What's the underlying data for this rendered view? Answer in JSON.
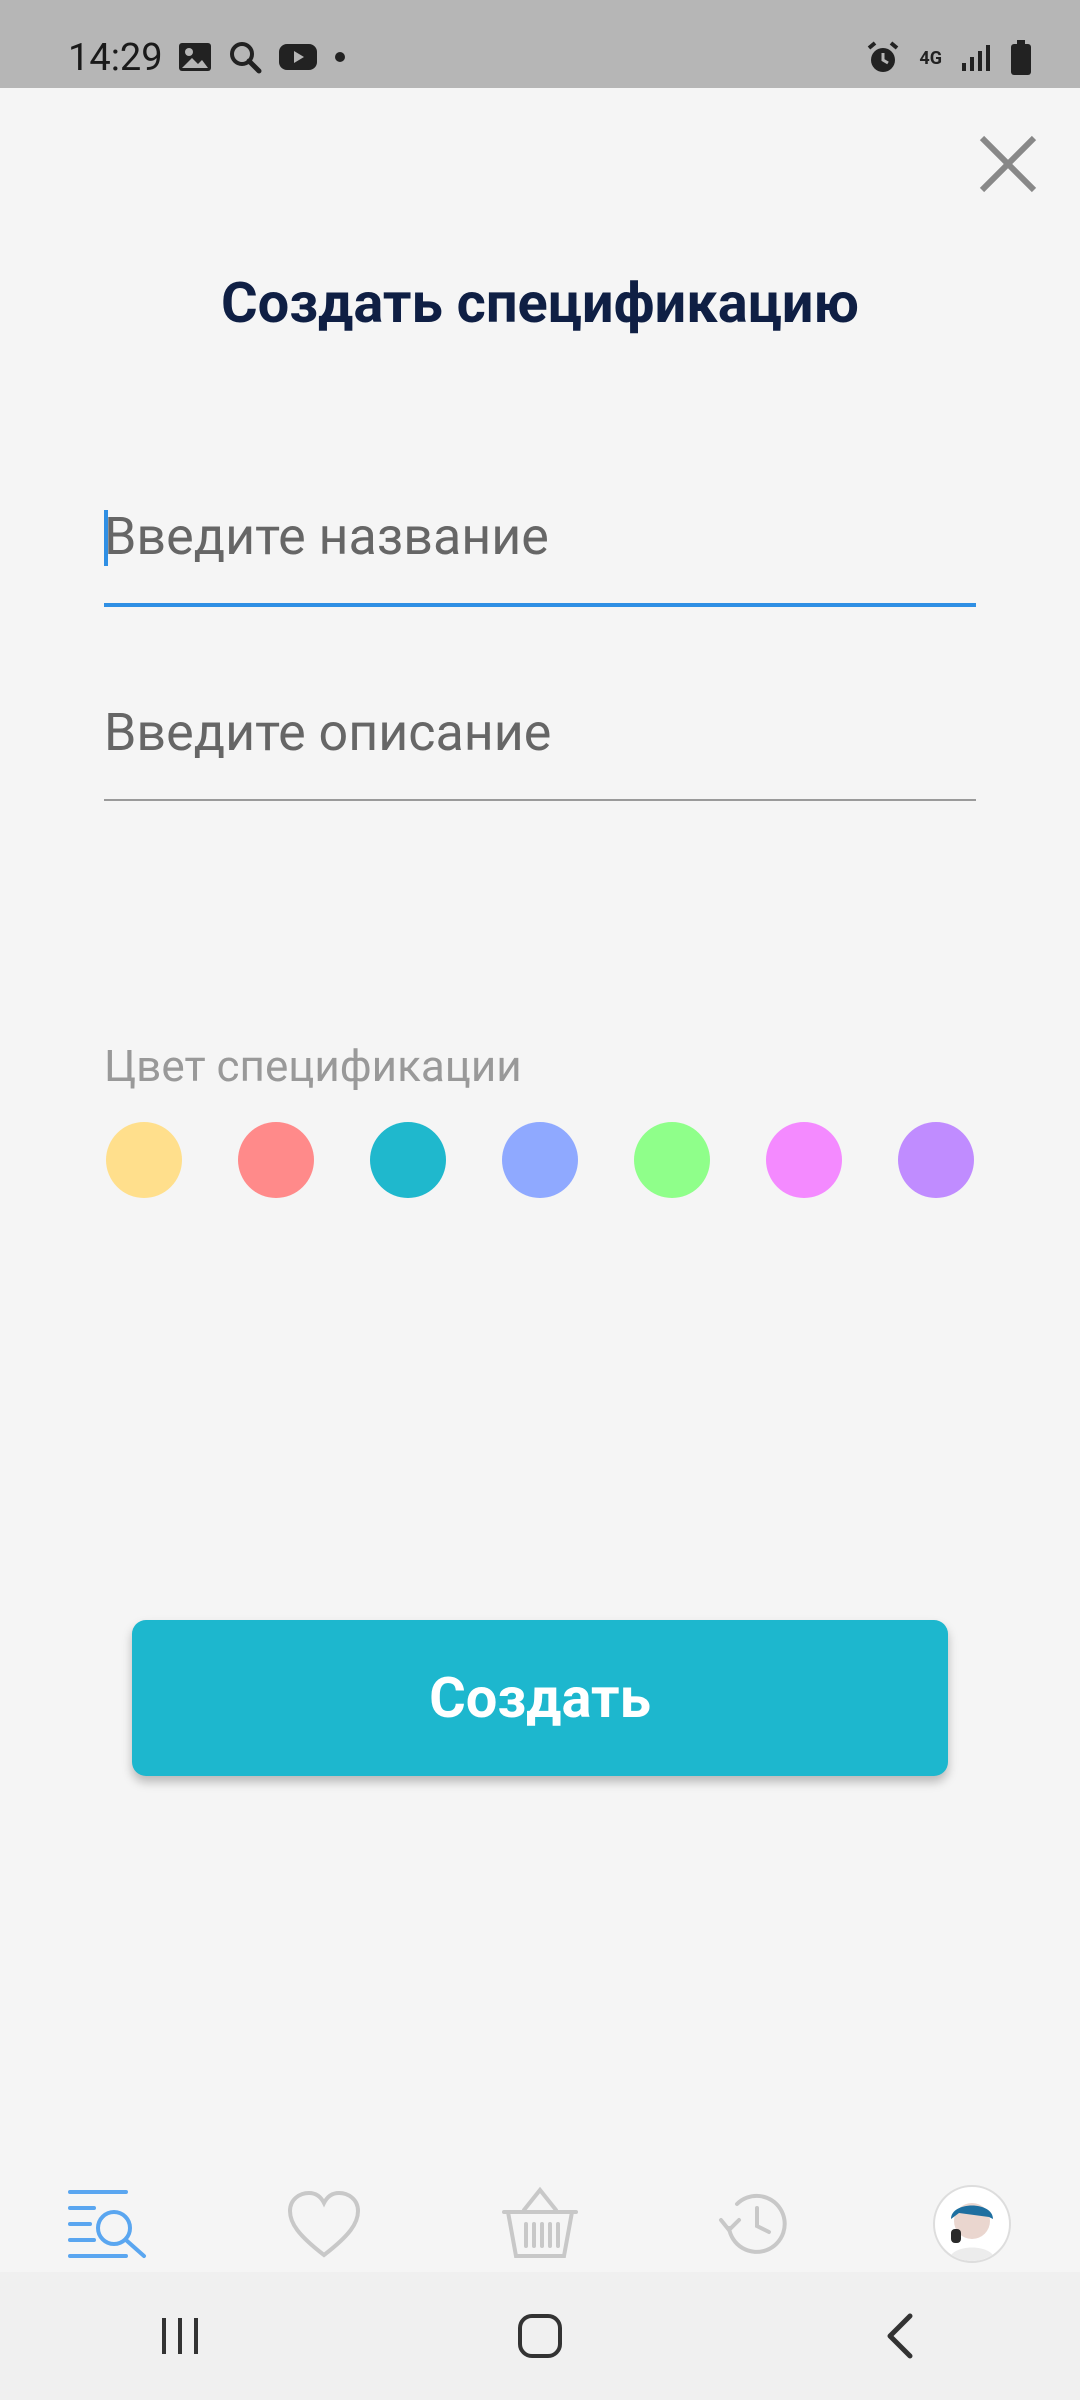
{
  "status": {
    "time": "14:29",
    "network": "4G"
  },
  "title": "Создать спецификацию",
  "fields": {
    "name_placeholder": "Введите название",
    "description_placeholder": "Введите описание"
  },
  "color_label": "Цвет спецификации",
  "colors": [
    "#ffdf8c",
    "#ff8a8a",
    "#1fb8cd",
    "#8fa9ff",
    "#8fff8a",
    "#f48aff",
    "#c08cff"
  ],
  "create_label": "Создать",
  "accent": "#2f8fe4",
  "nav_icons": [
    "search-list-icon",
    "heart-icon",
    "basket-icon",
    "history-icon",
    "avatar"
  ],
  "system_nav": [
    "recent-apps-icon",
    "home-icon",
    "back-icon"
  ]
}
